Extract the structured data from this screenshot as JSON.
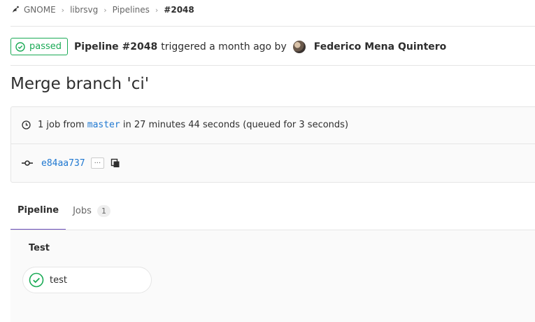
{
  "breadcrumb": {
    "items": [
      "GNOME",
      "librsvg",
      "Pipelines"
    ],
    "current": "#2048"
  },
  "header": {
    "status": "passed",
    "pipeline_label": "Pipeline #2048",
    "triggered_text": "triggered a month ago by",
    "author": "Federico Mena Quintero"
  },
  "title": "Merge branch 'ci'",
  "info": {
    "prefix": "1 job from",
    "branch": "master",
    "duration": "in 27 minutes 44 seconds (queued for 3 seconds)",
    "commit_sha": "e84aa737",
    "ellipsis": "..."
  },
  "tabs": [
    {
      "label": "Pipeline"
    },
    {
      "label": "Jobs",
      "count": "1"
    }
  ],
  "graph": {
    "stage": "Test",
    "job": "test"
  },
  "colors": {
    "success": "#1aaa55",
    "link": "#1f78d1",
    "active_tab": "#6b4fbb"
  }
}
